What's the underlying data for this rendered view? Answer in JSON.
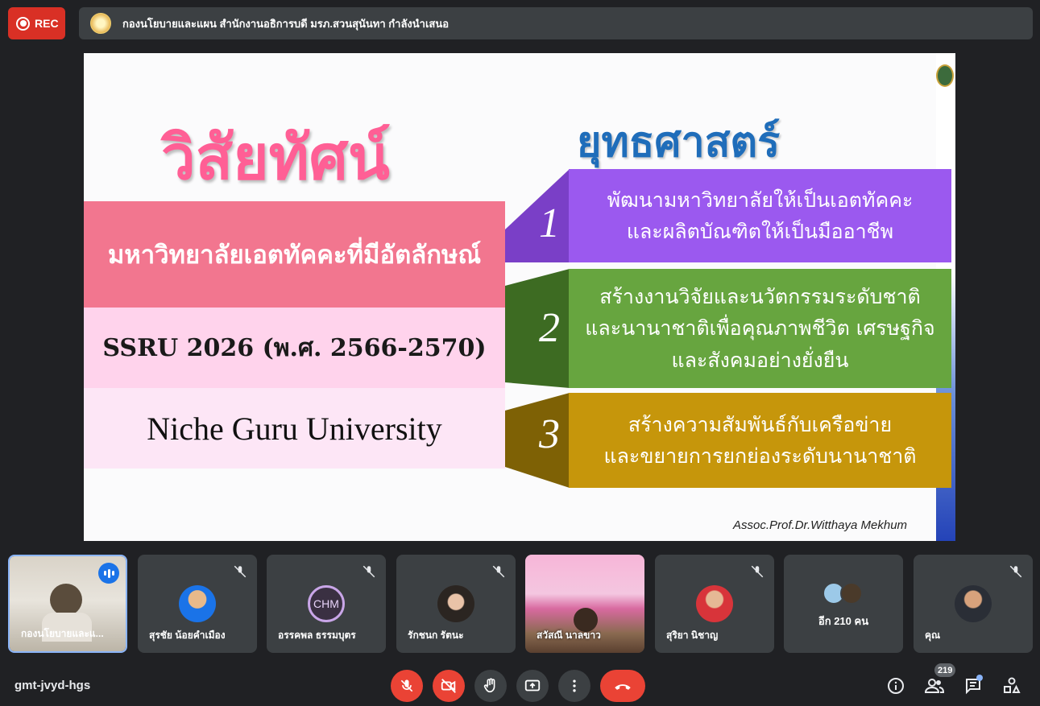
{
  "recording": {
    "label": "REC"
  },
  "presenter": {
    "text": "กองนโยบายและแผน สำนักงานอธิการบดี มรภ.สวนสุนันทา กำลังนำเสนอ"
  },
  "slide": {
    "vision_title": "วิสัยทัศน์",
    "strategy_title": "ยุทธศาสตร์",
    "vision_statement": "มหาวิทยาลัยเอตทัคคะที่มีอัตลักษณ์",
    "plan_period": "SSRU 2026 (พ.ศ. 2566-2570)",
    "tagline": "Niche Guru University",
    "strategies": [
      {
        "number": "1",
        "line1": "พัฒนามหาวิทยาลัยให้เป็นเอตทัคคะ",
        "line2": "และผลิตบัณฑิตให้เป็นมืออาชีพ"
      },
      {
        "number": "2",
        "line1": "สร้างงานวิจัยและนวัตกรรมระดับชาติ",
        "line2": "และนานาชาติเพื่อคุณภาพชีวิต เศรษฐกิจ",
        "line3": "และสังคมอย่างยั่งยืน"
      },
      {
        "number": "3",
        "line1": "สร้างความสัมพันธ์กับเครือข่าย",
        "line2": "และขยายการยกย่องระดับนานาชาติ"
      }
    ],
    "credit": "Assoc.Prof.Dr.Witthaya Mekhum",
    "colors": {
      "pink": "#f2768f",
      "purple": "#9b59ef",
      "green": "#67a53f",
      "gold": "#c6960b",
      "blue_title": "#1f6dba"
    }
  },
  "participants": [
    {
      "name": "กองนโยบายและแ...",
      "speaking": true
    },
    {
      "name": "สุรชัย น้อยคำเมือง",
      "muted": true,
      "icon": "mic-off-icon"
    },
    {
      "name": "อรรคพล ธรรมบุตร",
      "muted": true,
      "initials": "CHM"
    },
    {
      "name": "รักชนก รัตนะ",
      "muted": true
    },
    {
      "name": "สวัสณี นาลขาว",
      "muted": true
    },
    {
      "name": "สุริยา นิชาญ",
      "muted": true
    },
    {
      "name": "อีก 210 คน"
    },
    {
      "name": "คุณ",
      "muted": true
    }
  ],
  "bottom_bar": {
    "meeting_code": "gmt-jvyd-hgs",
    "people_count": "219",
    "icons": [
      "mic-off-icon",
      "camera-off-icon",
      "raise-hand-icon",
      "present-icon",
      "more-icon",
      "end-call-icon",
      "info-icon",
      "people-icon",
      "chat-icon",
      "activities-icon"
    ]
  }
}
